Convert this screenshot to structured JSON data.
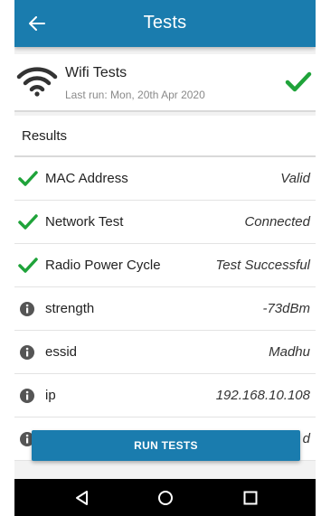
{
  "appbar": {
    "title": "Tests"
  },
  "summary": {
    "name": "Wifi Tests",
    "last_run": "Last run: Mon, 20th Apr 2020"
  },
  "results": {
    "header": "Results"
  },
  "rows": [
    {
      "label": "MAC Address",
      "value": "Valid",
      "icon": "check-icon"
    },
    {
      "label": "Network Test",
      "value": "Connected",
      "icon": "check-icon"
    },
    {
      "label": "Radio Power Cycle",
      "value": "Test Successful",
      "icon": "check-icon"
    },
    {
      "label": "strength",
      "value": "-73dBm",
      "icon": "info-icon"
    },
    {
      "label": "essid",
      "value": "Madhu",
      "icon": "info-icon"
    },
    {
      "label": "ip",
      "value": "192.168.10.108",
      "icon": "info-icon"
    },
    {
      "label": "",
      "value": "d",
      "icon": "info-icon"
    }
  ],
  "run_button": {
    "label": "RUN TESTS"
  },
  "colors": {
    "primary": "#1a7cae",
    "success": "#1fa33a",
    "info": "#555555"
  }
}
